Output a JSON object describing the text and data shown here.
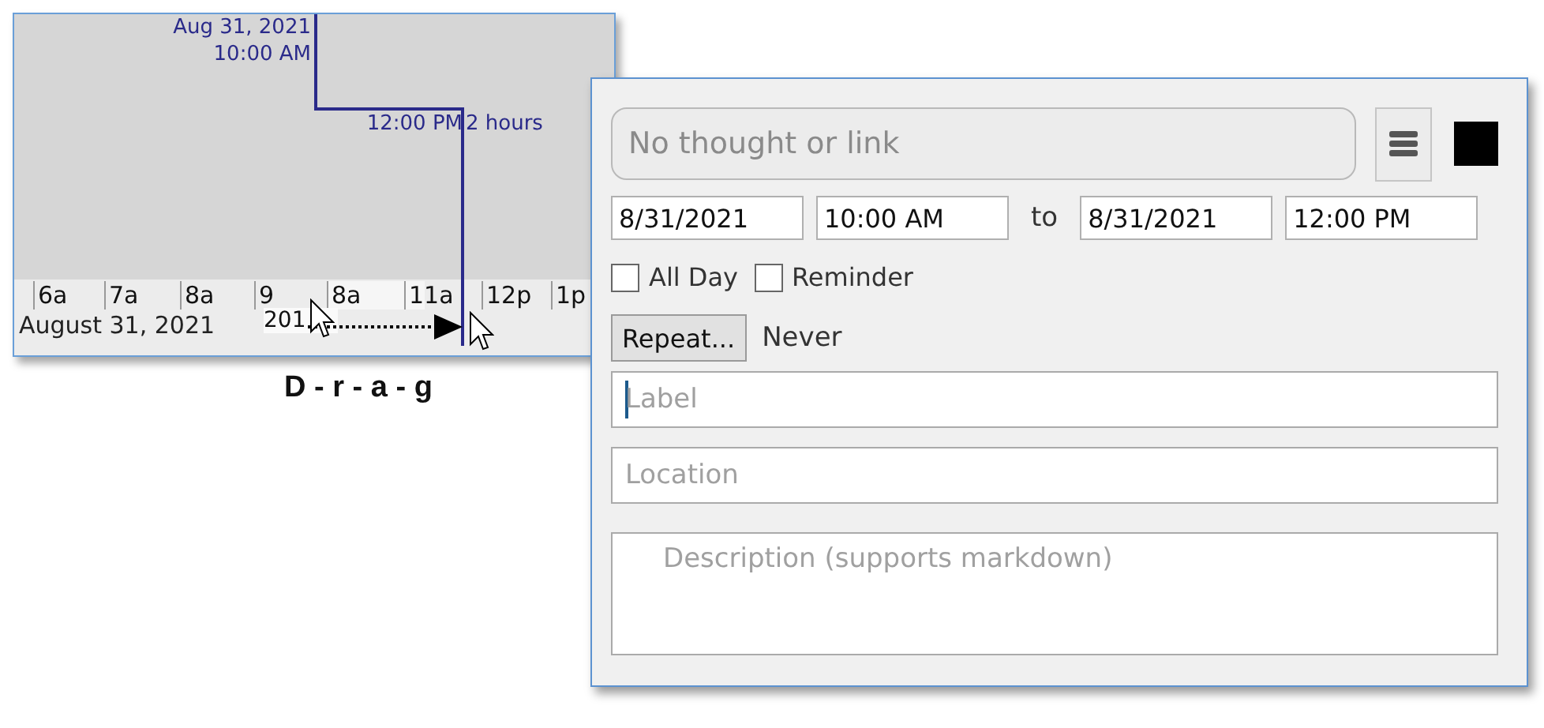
{
  "timeline": {
    "start_date": "Aug 31, 2021",
    "start_time": "10:00 AM",
    "end_time": "12:00 PM",
    "duration": "2 hours",
    "hours": [
      "6a",
      "7a",
      "8a",
      "9",
      "8a",
      "11a",
      "12p",
      "1p"
    ],
    "date": "August 31, 2021",
    "ghost_text": "201"
  },
  "caption": "D - r - a - g",
  "dialog": {
    "thought": {
      "placeholder": "No thought or link"
    },
    "color": "#000000",
    "start_date": "8/31/2021",
    "start_time": "10:00 AM",
    "to": "to",
    "end_date": "8/31/2021",
    "end_time": "12:00 PM",
    "checks": [
      {
        "label": "All Day",
        "checked": false
      },
      {
        "label": "Reminder",
        "checked": false
      }
    ],
    "repeat_button": "Repeat...",
    "repeat_value": "Never",
    "label": {
      "placeholder": "Label",
      "focused": true
    },
    "location": {
      "placeholder": "Location"
    },
    "description": {
      "placeholder": "Description (supports markdown)"
    }
  }
}
